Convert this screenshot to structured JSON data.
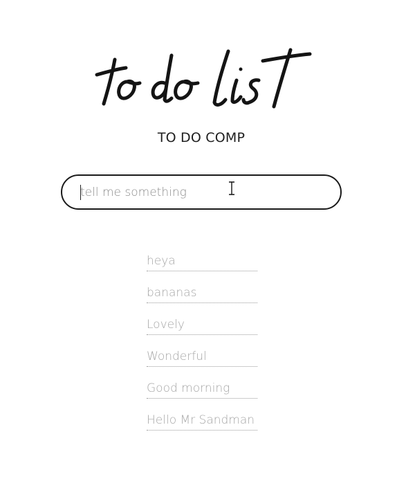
{
  "header": {
    "logo_text": "to do list",
    "subtitle": "TO DO COMP"
  },
  "input": {
    "placeholder": "tell me something",
    "value": ""
  },
  "icons": {
    "cursor": "text-cursor-icon"
  },
  "todos": [
    {
      "label": "heya"
    },
    {
      "label": "bananas"
    },
    {
      "label": "Lovely"
    },
    {
      "label": "Wonderful"
    },
    {
      "label": "Good morning"
    },
    {
      "label": "Hello Mr Sandman"
    }
  ],
  "colors": {
    "text_dark": "#1e1e1e",
    "item_text": "#a6a6a6",
    "border": "#1a1a1a"
  }
}
